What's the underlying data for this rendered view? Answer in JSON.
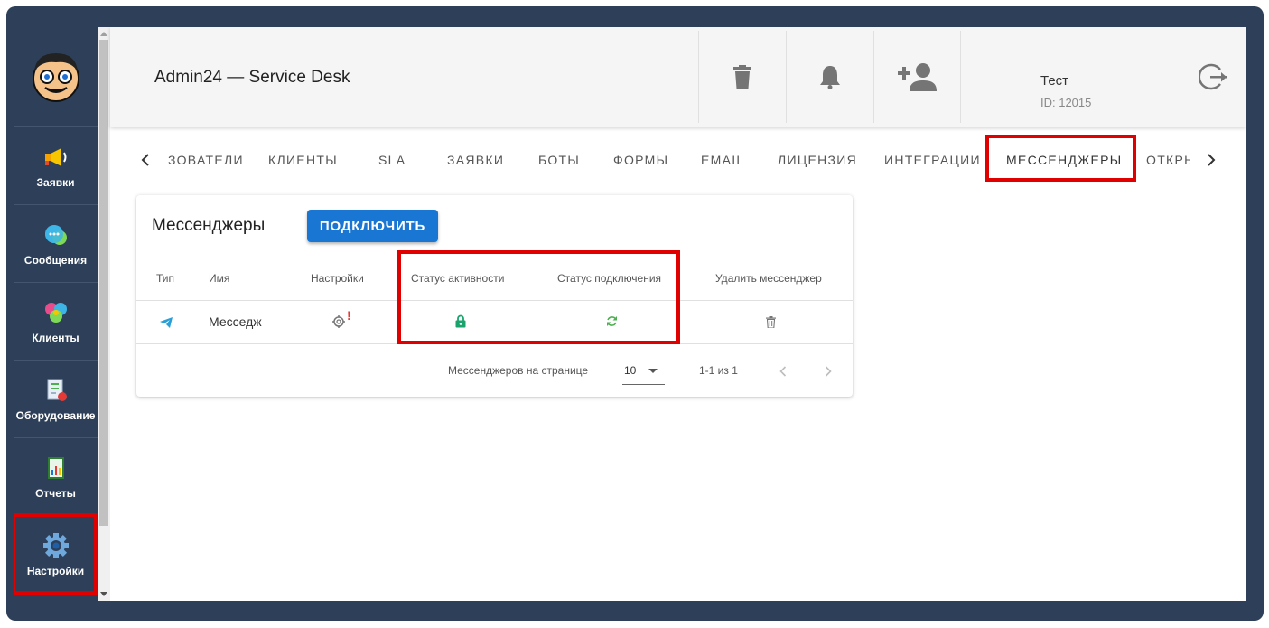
{
  "header": {
    "title": "Admin24 — Service Desk",
    "user_name": "Тест",
    "user_id": "ID: 12015"
  },
  "sidebar": {
    "items": [
      {
        "label": "Заявки",
        "icon": "megaphone-icon"
      },
      {
        "label": "Сообщения",
        "icon": "chat-bubbles-icon"
      },
      {
        "label": "Клиенты",
        "icon": "clients-icon"
      },
      {
        "label": "Оборудование",
        "icon": "equipment-icon"
      },
      {
        "label": "Отчеты",
        "icon": "report-icon"
      },
      {
        "label": "Настройки",
        "icon": "gear-icon"
      }
    ]
  },
  "tabs": [
    "ЗОВАТЕЛИ",
    "КЛИЕНТЫ",
    "SLA",
    "ЗАЯВКИ",
    "БОТЫ",
    "ФОРМЫ",
    "EMAIL",
    "ЛИЦЕНЗИЯ",
    "ИНТЕГРАЦИИ",
    "МЕССЕНДЖЕРЫ",
    "ОТКРЬ"
  ],
  "card": {
    "title": "Мессенджеры",
    "connect_label": "ПОДКЛЮЧИТЬ",
    "columns": [
      "Тип",
      "Имя",
      "Настройки",
      "Статус активности",
      "Статус подключения",
      "Удалить мессенджер"
    ],
    "rows": [
      {
        "type_icon": "telegram-icon",
        "name": "Месседж",
        "settings_icon": "gear-icon",
        "settings_alert": "!",
        "activity_icon": "lock-icon",
        "connection_icon": "sync-icon",
        "delete_icon": "trash-icon"
      }
    ],
    "footer": {
      "per_page_label": "Мессенджеров на странице",
      "per_page_value": "10",
      "range": "1-1 из 1"
    }
  },
  "colors": {
    "frame": "#2e4059",
    "primary": "#1976d2",
    "highlight": "#e00000",
    "active_green": "#1aa36b",
    "sync_green": "#4caf50"
  }
}
